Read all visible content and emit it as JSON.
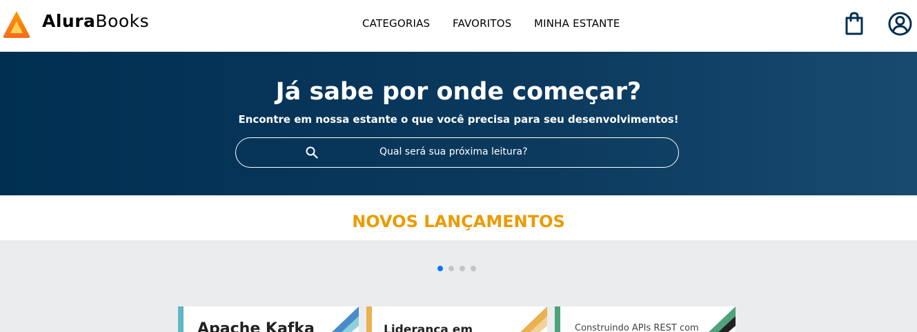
{
  "header": {
    "brand_bold": "Alura",
    "brand_light": "Books",
    "nav": [
      "CATEGORIAS",
      "FAVORITOS",
      "MINHA ESTANTE"
    ],
    "icons": [
      "logo-icon",
      "shopping-bag-icon",
      "user-account-icon"
    ]
  },
  "hero": {
    "title": "Já sabe por onde começar?",
    "subtitle": "Encontre em nossa estante o que você precisa para seu desenvolvimentos!",
    "search_placeholder": "Qual será sua próxima leitura?"
  },
  "section": {
    "title": "NOVOS LANÇAMENTOS"
  },
  "carousel": {
    "dots": 4,
    "active_dot": 1,
    "books": [
      {
        "title": "Apache Kafka",
        "accent": "#5FB6C6"
      },
      {
        "title": "Liderança em",
        "accent": "#EBB04F"
      },
      {
        "title": "Construindo APIs REST com",
        "accent": "#4EA37A"
      }
    ]
  },
  "colors": {
    "header_bg": "#FFFFFF",
    "hero_bg": "#002F52",
    "section_title": "#EB9B00",
    "carousel_bg": "#EBECEE",
    "active_dot": "#0076FF",
    "logo_orange": "#EB9B00"
  }
}
